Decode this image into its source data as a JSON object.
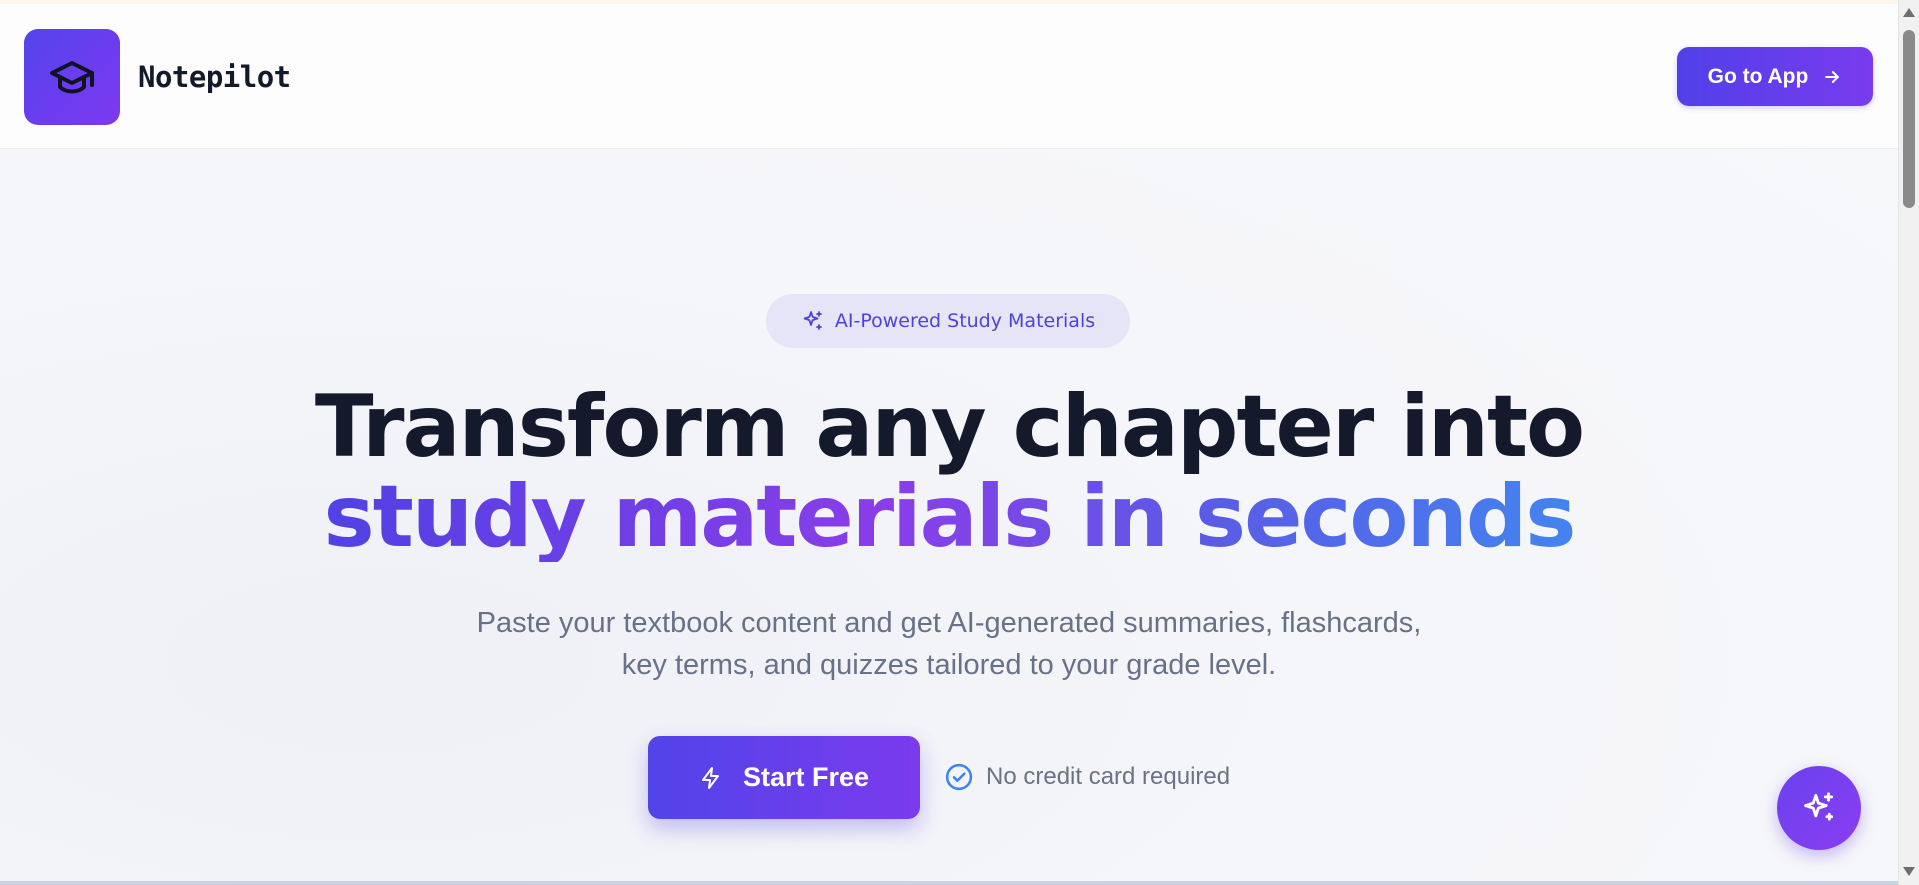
{
  "header": {
    "brand_name": "Notepilot",
    "logo_icon": "graduation-cap-icon",
    "cta_label": "Go to App",
    "cta_icon": "arrow-right-icon"
  },
  "hero": {
    "badge_text": "AI-Powered Study Materials",
    "badge_icon": "sparkles-icon",
    "headline_line1": "Transform any chapter into",
    "headline_line2": "study materials in seconds",
    "subtitle": "Paste your textbook content and get AI-generated summaries, flashcards, key terms, and quizzes tailored to your grade level.",
    "primary_button_label": "Start Free",
    "primary_button_icon": "lightning-icon",
    "note_text": "No credit card required",
    "note_icon": "check-circle-icon"
  },
  "fab": {
    "icon": "sparkles-icon"
  },
  "colors": {
    "primary_start": "#5144E8",
    "primary_end": "#7B3AEE",
    "gradient_text_end": "#4384EF",
    "heading_text": "#141A2C",
    "muted_text": "#687185",
    "badge_bg": "#E6E4F7",
    "badge_text": "#4F43D6",
    "check_blue": "#3B82F6"
  }
}
